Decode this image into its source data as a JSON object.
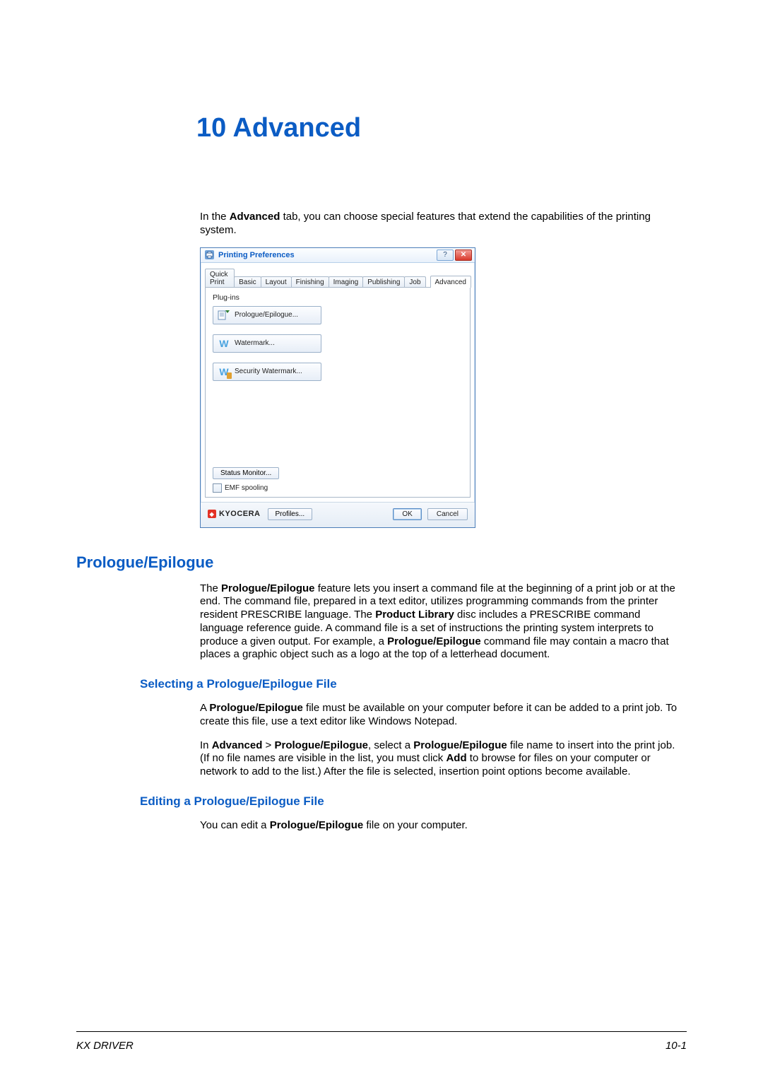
{
  "chapter": {
    "number_label": "10",
    "title": "Advanced"
  },
  "intro_prefix": "In the ",
  "intro_bold": "Advanced",
  "intro_suffix": " tab, you can choose special features that extend the capabilities of the printing system.",
  "dialog": {
    "title": "Printing Preferences",
    "help_glyph": "?",
    "close_glyph": "✕",
    "tabs": [
      "Quick Print",
      "Basic",
      "Layout",
      "Finishing",
      "Imaging",
      "Publishing",
      "Job"
    ],
    "active_tab": "Advanced",
    "plugins_label": "Plug-ins",
    "buttons": {
      "prologue": "Prologue/Epilogue...",
      "watermark": "Watermark...",
      "security_watermark": "Security Watermark..."
    },
    "status_monitor_label": "Status Monitor...",
    "emf_spooling_label": "EMF spooling",
    "brand": "KYOCERA",
    "profiles_label": "Profiles...",
    "ok_label": "OK",
    "cancel_label": "Cancel"
  },
  "section_prologue_heading": "Prologue/Epilogue",
  "prologue_para": {
    "p1a": "The ",
    "p1b": "Prologue/Epilogue",
    "p1c": " feature lets you insert a command file at the beginning of a print job or at the end. The command file, prepared in a text editor, utilizes programming commands from the printer resident PRESCRIBE language. The ",
    "p1d": "Product Library",
    "p1e": " disc includes a PRESCRIBE command language reference guide. A command file is a set of instructions the printing system interprets to produce a given output. For example, a ",
    "p1f": "Prologue/Epilogue",
    "p1g": " command file may contain a macro that places a graphic object such as a logo at the top of a letterhead document."
  },
  "subsection_select_heading": "Selecting a Prologue/Epilogue File",
  "select_para1a": "A ",
  "select_para1b": "Prologue/Epilogue",
  "select_para1c": " file must be available on your computer before it can be added to a print job. To create this file, use a text editor like Windows Notepad.",
  "select_para2a": "In ",
  "select_para2b": "Advanced",
  "select_para2gt": " > ",
  "select_para2c": "Prologue/Epilogue",
  "select_para2d": ", select a ",
  "select_para2e": "Prologue/Epilogue",
  "select_para2f": " file name to insert into the print job. (If no file names are visible in the list, you must click ",
  "select_para2g": "Add",
  "select_para2h": " to browse for files on your computer or network to add to the list.) After the file is selected, insertion point options become available.",
  "subsection_edit_heading": "Editing a Prologue/Epilogue File",
  "edit_para_a": "You can edit a ",
  "edit_para_b": "Prologue/Epilogue",
  "edit_para_c": " file on your computer.",
  "footer": {
    "left": "KX DRIVER",
    "right": "10-1"
  }
}
